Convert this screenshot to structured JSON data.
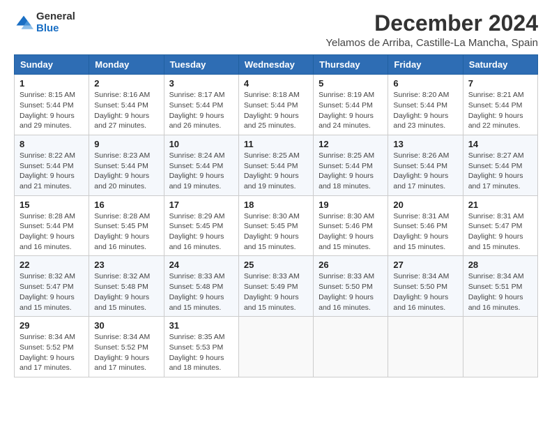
{
  "logo": {
    "line1": "General",
    "line2": "Blue"
  },
  "title": "December 2024",
  "location": "Yelamos de Arriba, Castille-La Mancha, Spain",
  "weekdays": [
    "Sunday",
    "Monday",
    "Tuesday",
    "Wednesday",
    "Thursday",
    "Friday",
    "Saturday"
  ],
  "weeks": [
    [
      {
        "day": "1",
        "rise": "8:15 AM",
        "set": "5:44 PM",
        "daylight": "9 hours and 29 minutes."
      },
      {
        "day": "2",
        "rise": "8:16 AM",
        "set": "5:44 PM",
        "daylight": "9 hours and 27 minutes."
      },
      {
        "day": "3",
        "rise": "8:17 AM",
        "set": "5:44 PM",
        "daylight": "9 hours and 26 minutes."
      },
      {
        "day": "4",
        "rise": "8:18 AM",
        "set": "5:44 PM",
        "daylight": "9 hours and 25 minutes."
      },
      {
        "day": "5",
        "rise": "8:19 AM",
        "set": "5:44 PM",
        "daylight": "9 hours and 24 minutes."
      },
      {
        "day": "6",
        "rise": "8:20 AM",
        "set": "5:44 PM",
        "daylight": "9 hours and 23 minutes."
      },
      {
        "day": "7",
        "rise": "8:21 AM",
        "set": "5:44 PM",
        "daylight": "9 hours and 22 minutes."
      }
    ],
    [
      {
        "day": "8",
        "rise": "8:22 AM",
        "set": "5:44 PM",
        "daylight": "9 hours and 21 minutes."
      },
      {
        "day": "9",
        "rise": "8:23 AM",
        "set": "5:44 PM",
        "daylight": "9 hours and 20 minutes."
      },
      {
        "day": "10",
        "rise": "8:24 AM",
        "set": "5:44 PM",
        "daylight": "9 hours and 19 minutes."
      },
      {
        "day": "11",
        "rise": "8:25 AM",
        "set": "5:44 PM",
        "daylight": "9 hours and 19 minutes."
      },
      {
        "day": "12",
        "rise": "8:25 AM",
        "set": "5:44 PM",
        "daylight": "9 hours and 18 minutes."
      },
      {
        "day": "13",
        "rise": "8:26 AM",
        "set": "5:44 PM",
        "daylight": "9 hours and 17 minutes."
      },
      {
        "day": "14",
        "rise": "8:27 AM",
        "set": "5:44 PM",
        "daylight": "9 hours and 17 minutes."
      }
    ],
    [
      {
        "day": "15",
        "rise": "8:28 AM",
        "set": "5:44 PM",
        "daylight": "9 hours and 16 minutes."
      },
      {
        "day": "16",
        "rise": "8:28 AM",
        "set": "5:45 PM",
        "daylight": "9 hours and 16 minutes."
      },
      {
        "day": "17",
        "rise": "8:29 AM",
        "set": "5:45 PM",
        "daylight": "9 hours and 16 minutes."
      },
      {
        "day": "18",
        "rise": "8:30 AM",
        "set": "5:45 PM",
        "daylight": "9 hours and 15 minutes."
      },
      {
        "day": "19",
        "rise": "8:30 AM",
        "set": "5:46 PM",
        "daylight": "9 hours and 15 minutes."
      },
      {
        "day": "20",
        "rise": "8:31 AM",
        "set": "5:46 PM",
        "daylight": "9 hours and 15 minutes."
      },
      {
        "day": "21",
        "rise": "8:31 AM",
        "set": "5:47 PM",
        "daylight": "9 hours and 15 minutes."
      }
    ],
    [
      {
        "day": "22",
        "rise": "8:32 AM",
        "set": "5:47 PM",
        "daylight": "9 hours and 15 minutes."
      },
      {
        "day": "23",
        "rise": "8:32 AM",
        "set": "5:48 PM",
        "daylight": "9 hours and 15 minutes."
      },
      {
        "day": "24",
        "rise": "8:33 AM",
        "set": "5:48 PM",
        "daylight": "9 hours and 15 minutes."
      },
      {
        "day": "25",
        "rise": "8:33 AM",
        "set": "5:49 PM",
        "daylight": "9 hours and 15 minutes."
      },
      {
        "day": "26",
        "rise": "8:33 AM",
        "set": "5:50 PM",
        "daylight": "9 hours and 16 minutes."
      },
      {
        "day": "27",
        "rise": "8:34 AM",
        "set": "5:50 PM",
        "daylight": "9 hours and 16 minutes."
      },
      {
        "day": "28",
        "rise": "8:34 AM",
        "set": "5:51 PM",
        "daylight": "9 hours and 16 minutes."
      }
    ],
    [
      {
        "day": "29",
        "rise": "8:34 AM",
        "set": "5:52 PM",
        "daylight": "9 hours and 17 minutes."
      },
      {
        "day": "30",
        "rise": "8:34 AM",
        "set": "5:52 PM",
        "daylight": "9 hours and 17 minutes."
      },
      {
        "day": "31",
        "rise": "8:35 AM",
        "set": "5:53 PM",
        "daylight": "9 hours and 18 minutes."
      },
      null,
      null,
      null,
      null
    ]
  ]
}
